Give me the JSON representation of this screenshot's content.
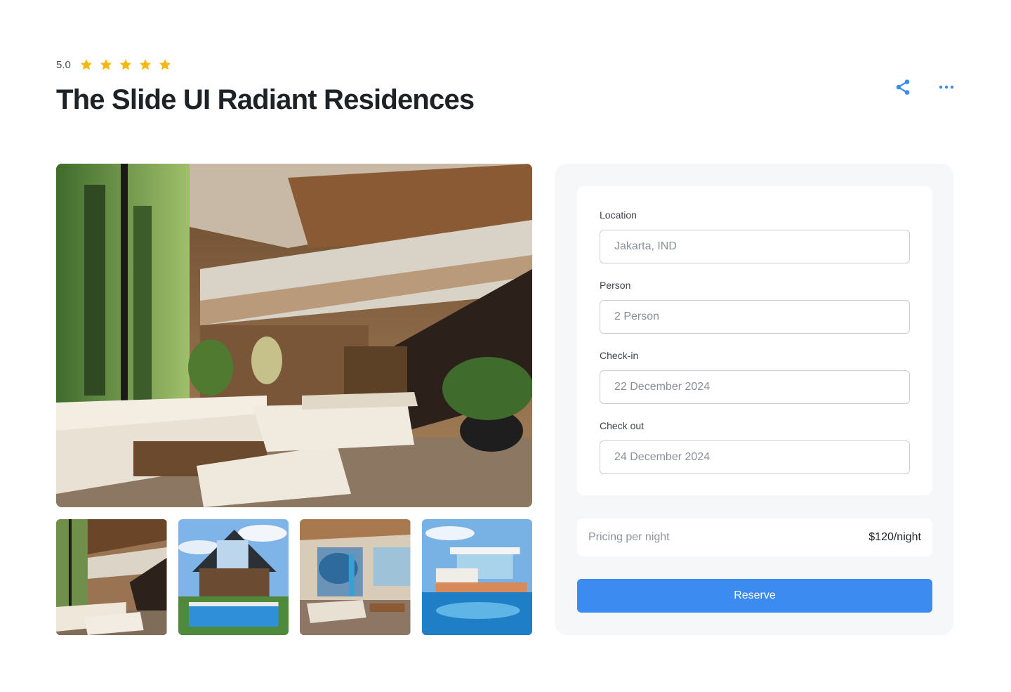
{
  "listing": {
    "rating": "5.0",
    "star_count": 5,
    "title": "The Slide UI Radiant Residences"
  },
  "actions": {
    "share_icon": "share-icon",
    "more_icon": "more-dots-icon"
  },
  "gallery": {
    "hero": "living-room-interior-photo",
    "thumbnails": [
      "interior-staircase-photo",
      "house-with-pool-photo",
      "beach-loft-interior-photo",
      "modern-villa-pool-photo"
    ]
  },
  "booking": {
    "location": {
      "label": "Location",
      "value": "Jakarta, IND"
    },
    "person": {
      "label": "Person",
      "value": "2 Person"
    },
    "checkin": {
      "label": "Check-in",
      "value": "22 December 2024"
    },
    "checkout": {
      "label": "Check out",
      "value": "24 December 2024"
    },
    "pricing_label": "Pricing per night",
    "pricing_value": "$120/night",
    "reserve_label": "Reserve"
  },
  "colors": {
    "accent": "#3b8bf0",
    "star": "#f5b80f",
    "panel_bg": "#f6f7f9"
  }
}
